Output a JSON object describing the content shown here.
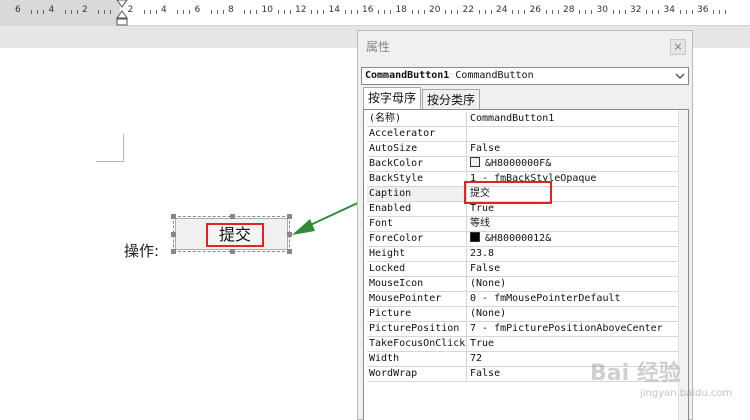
{
  "ruler": {
    "numbers": [
      "6",
      "4",
      "2",
      "2",
      "4",
      "6",
      "8",
      "10",
      "12",
      "14",
      "16",
      "18",
      "20",
      "22",
      "24",
      "26",
      "28",
      "30",
      "32",
      "34",
      "36"
    ]
  },
  "document": {
    "label": "操作:",
    "button_caption": "提交"
  },
  "properties": {
    "title": "属性",
    "close_glyph": "×",
    "object_name": "CommandButton1",
    "object_type": "CommandButton",
    "tabs": [
      "按字母序",
      "按分类序"
    ],
    "rows": [
      {
        "name": "(名称)",
        "value": "CommandButton1"
      },
      {
        "name": "Accelerator",
        "value": ""
      },
      {
        "name": "AutoSize",
        "value": "False"
      },
      {
        "name": "BackColor",
        "value": "&H8000000F&",
        "swatch": "#f0f0f0"
      },
      {
        "name": "BackStyle",
        "value": "1 - fmBackStyleOpaque"
      },
      {
        "name": "Caption",
        "value": "提交"
      },
      {
        "name": "Enabled",
        "value": "True"
      },
      {
        "name": "Font",
        "value": "等线"
      },
      {
        "name": "ForeColor",
        "value": "&H80000012&",
        "swatch": "#000000"
      },
      {
        "name": "Height",
        "value": "23.8"
      },
      {
        "name": "Locked",
        "value": "False"
      },
      {
        "name": "MouseIcon",
        "value": "(None)"
      },
      {
        "name": "MousePointer",
        "value": "0 - fmMousePointerDefault"
      },
      {
        "name": "Picture",
        "value": "(None)"
      },
      {
        "name": "PicturePosition",
        "value": "7 - fmPicturePositionAboveCenter"
      },
      {
        "name": "TakeFocusOnClick",
        "value": "True"
      },
      {
        "name": "Width",
        "value": "72"
      },
      {
        "name": "WordWrap",
        "value": "False"
      }
    ]
  },
  "watermark": {
    "logo": "Bai 经验",
    "url": "jingyan.baidu.com"
  },
  "colors": {
    "highlight_red": "#e02424",
    "arrow_green": "#2e8b3a"
  }
}
